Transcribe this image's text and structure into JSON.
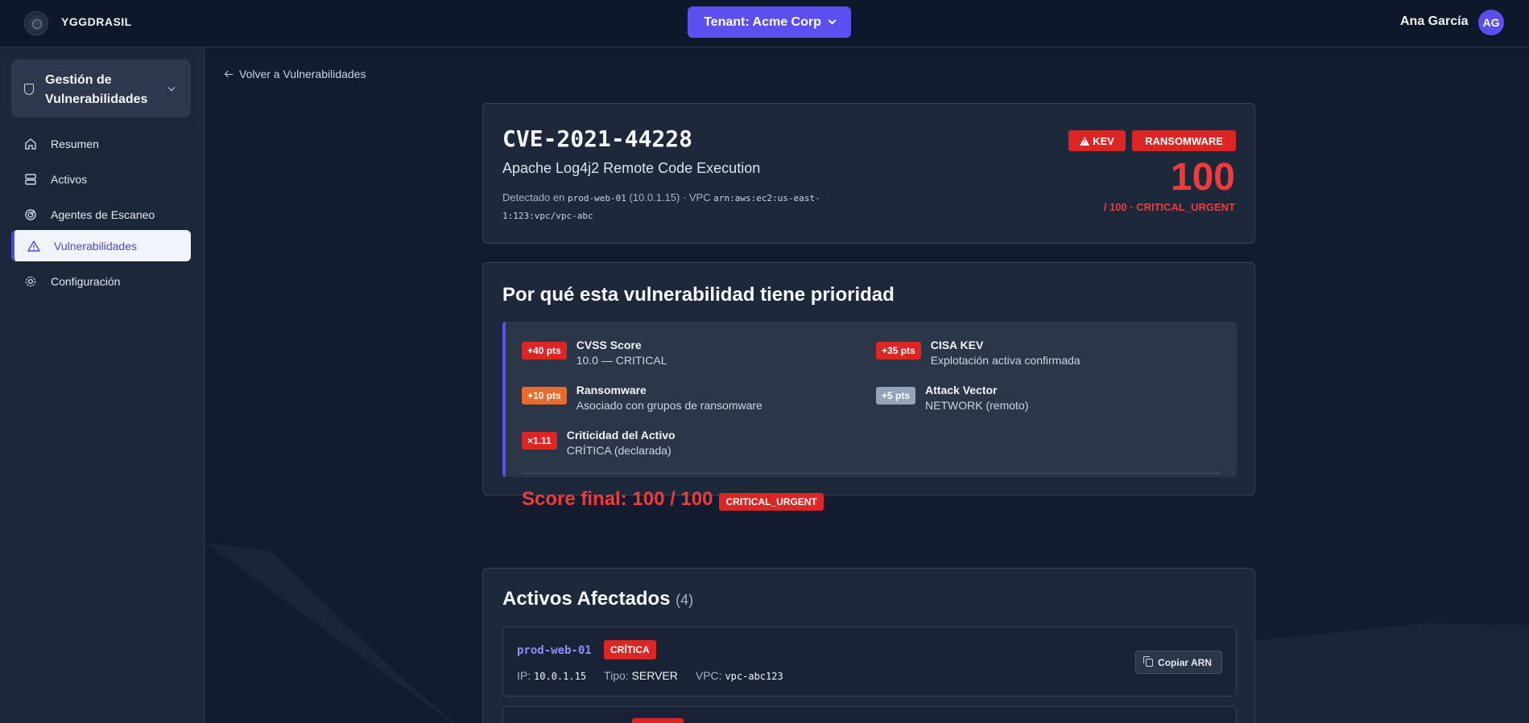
{
  "header": {
    "brand": "YGGDRASIL",
    "tenant_label": "Tenant: Acme Corp",
    "user_name": "Ana García",
    "user_initials": "AG"
  },
  "sidebar": {
    "group_title": "Gestión de Vulnerabilidades",
    "items": [
      {
        "label": "Resumen",
        "icon": "home-icon"
      },
      {
        "label": "Activos",
        "icon": "server-icon"
      },
      {
        "label": "Agentes de Escaneo",
        "icon": "radar-icon"
      },
      {
        "label": "Vulnerabilidades",
        "icon": "warning-icon",
        "active": true
      },
      {
        "label": "Configuración",
        "icon": "gear-icon"
      }
    ]
  },
  "main": {
    "back_label": "Volver a Vulnerabilidades",
    "cve": {
      "id": "CVE-2021-44228",
      "title": "Apache Log4j2 Remote Code Execution",
      "detected_prefix": "Detectado en",
      "host": "prod-web-01",
      "ip_vpc_text": "(10.0.1.15) · VPC",
      "vpc_arn": "arn:aws:ec2:us-east-1:123:vpc/vpc-abc",
      "badge_kev": "KEV",
      "badge_ransomware": "RANSOMWARE",
      "score": "100",
      "score_sub": "/ 100 · CRITICAL_URGENT"
    },
    "priority": {
      "heading": "Por qué esta vulnerabilidad tiene prioridad",
      "factors": [
        {
          "pts": "+40 pts",
          "title": "CVSS Score",
          "desc": "10.0 — CRITICAL"
        },
        {
          "pts": "+35 pts",
          "title": "CISA KEV",
          "desc": "Explotación activa confirmada"
        },
        {
          "pts": "+10 pts",
          "title": "Ransomware",
          "desc": "Asociado con grupos de ransomware"
        },
        {
          "pts": "+5 pts",
          "title": "Attack Vector",
          "desc": "NETWORK (remoto)"
        },
        {
          "pts": "×1.11",
          "title": "Criticidad del Activo",
          "desc": "CRÍTICA (declarada)"
        }
      ],
      "final_text": "Score final: 100 / 100",
      "final_badge": "CRITICAL_URGENT"
    },
    "assets": {
      "heading": "Activos Afectados",
      "count": "(4)",
      "rows": [
        {
          "name": "prod-web-01",
          "criticality": "CRÍTICA",
          "ip_label": "IP:",
          "ip": "10.0.1.15",
          "type_label": "Tipo:",
          "type": "SERVER",
          "vpc_label": "VPC:",
          "vpc": "vpc-abc123",
          "copy_label": "Copiar ARN"
        }
      ]
    }
  }
}
